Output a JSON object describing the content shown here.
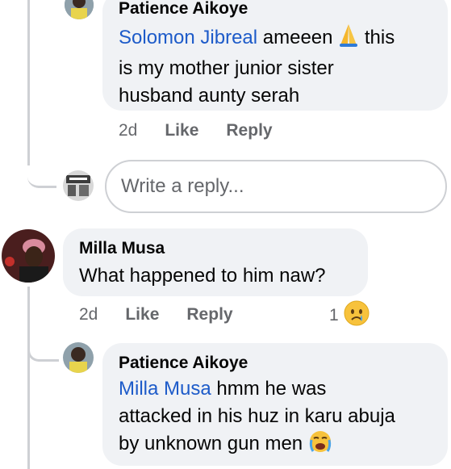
{
  "comment1": {
    "author": "Patience Aikoye",
    "mention": "Solomon Jibreal",
    "text_line1_after": "ameeen",
    "text_line1_end": "this",
    "text_line2": "is my mother junior sister",
    "text_line3": "husband aunty serah",
    "time": "2d",
    "like": "Like",
    "reply": "Reply",
    "emoji": "folded-hands"
  },
  "reply_input": {
    "placeholder": "Write a reply..."
  },
  "comment2": {
    "author": "Milla Musa",
    "text": "What happened to him naw?",
    "time": "2d",
    "like": "Like",
    "reply": "Reply",
    "reaction_count": "1",
    "reaction": "sad-face"
  },
  "comment3": {
    "author": "Patience Aikoye",
    "mention": "Milla Musa",
    "text_line1_after": "hmm he was",
    "text_line2": "attacked in his huz in karu abuja",
    "text_line3": "by unknown gun men",
    "emoji": "loudly-crying-face"
  },
  "colors": {
    "mention": "#1d5bc9",
    "bubble": "#f0f2f5",
    "meta": "#65676b",
    "thread_line": "#ced0d4"
  }
}
